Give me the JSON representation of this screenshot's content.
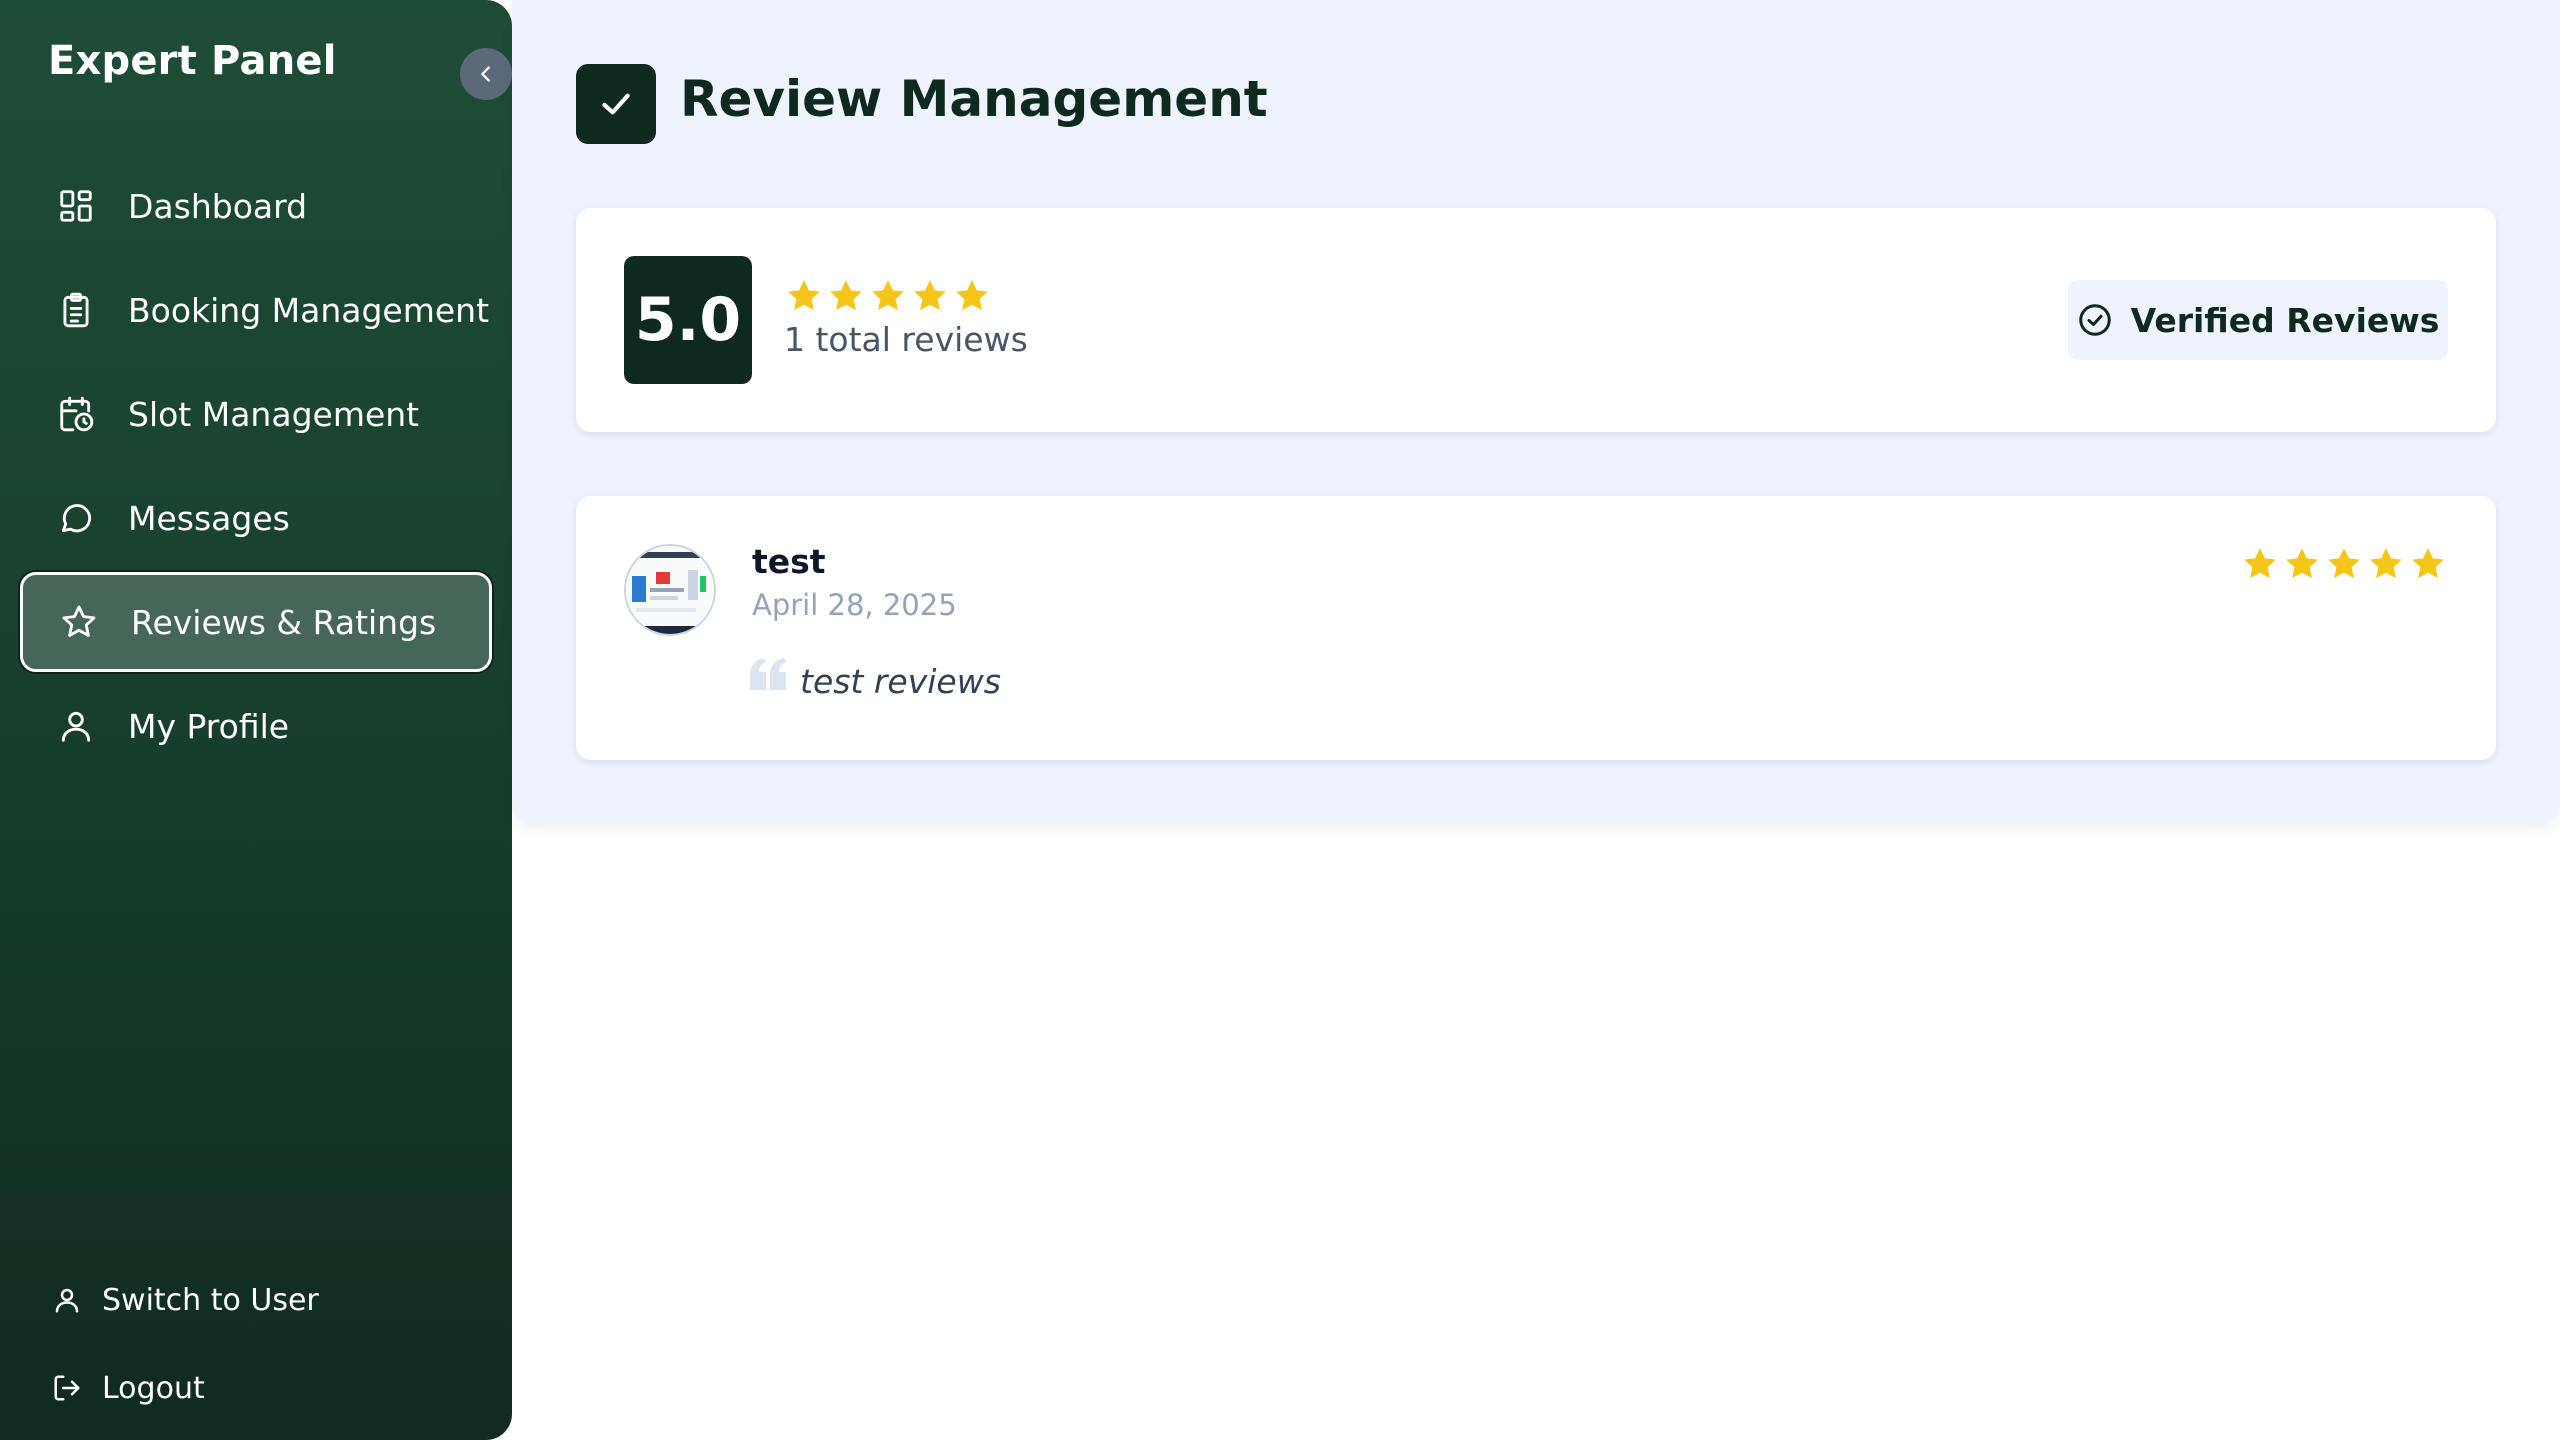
{
  "sidebar": {
    "brand": "Expert Panel",
    "items": [
      {
        "label": "Dashboard",
        "icon": "dashboard-icon"
      },
      {
        "label": "Booking Management",
        "icon": "clipboard-icon"
      },
      {
        "label": "Slot Management",
        "icon": "calendar-clock-icon"
      },
      {
        "label": "Messages",
        "icon": "chat-bubble-icon"
      },
      {
        "label": "Reviews & Ratings",
        "icon": "star-icon",
        "active": true
      },
      {
        "label": "My Profile",
        "icon": "user-icon"
      }
    ],
    "bottom": [
      {
        "label": "Switch to User",
        "icon": "user-icon"
      },
      {
        "label": "Logout",
        "icon": "logout-icon"
      }
    ]
  },
  "page": {
    "title": "Review Management"
  },
  "summary": {
    "average_rating": "5.0",
    "stars": 5,
    "total_reviews": "1 total reviews",
    "verified_label": "Verified Reviews"
  },
  "reviews": [
    {
      "name": "test",
      "date": "April 28, 2025",
      "text": "test reviews",
      "stars": 5
    }
  ],
  "colors": {
    "sidebar_dark": "#102a1f",
    "sidebar_light": "#1e4d37",
    "accent_dark": "#0e2a1f",
    "star": "#f5c518",
    "panel_bg": "#eef3fe"
  }
}
